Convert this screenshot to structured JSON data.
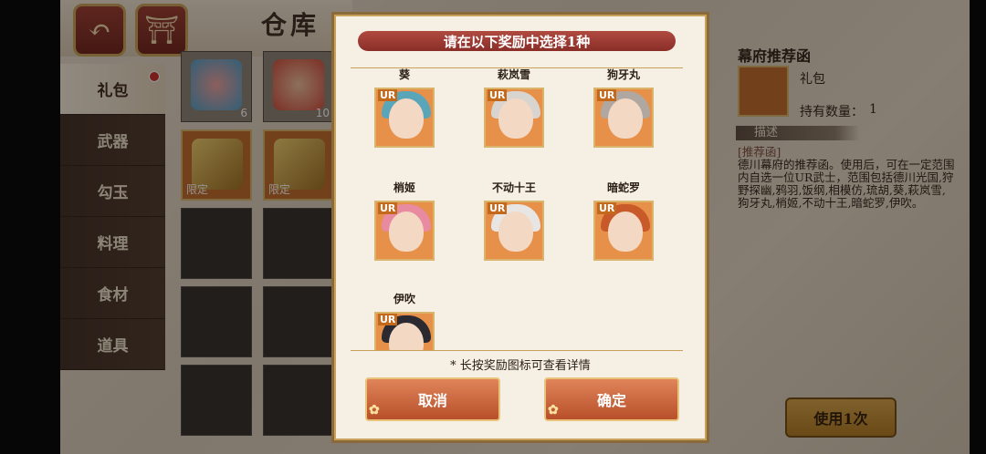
{
  "header": {
    "title": "仓库"
  },
  "sidebar": {
    "items": [
      {
        "label": "礼包",
        "active": true,
        "badge": true
      },
      {
        "label": "武器",
        "active": false
      },
      {
        "label": "勾玉",
        "active": false
      },
      {
        "label": "料理",
        "active": false
      },
      {
        "label": "食材",
        "active": false
      },
      {
        "label": "道具",
        "active": false
      }
    ]
  },
  "grid": {
    "items": [
      {
        "count": "6",
        "tag": ""
      },
      {
        "count": "10",
        "tag": ""
      },
      {
        "count": "",
        "tag": "限定"
      },
      {
        "count": "",
        "tag": "限定"
      }
    ]
  },
  "modal": {
    "title": "请在以下奖励中选择1种",
    "rewards": [
      {
        "name": "葵",
        "rarity": "UR"
      },
      {
        "name": "萩岚雪",
        "rarity": "UR"
      },
      {
        "name": "狗牙丸",
        "rarity": "UR"
      },
      {
        "name": "梢姬",
        "rarity": "UR"
      },
      {
        "name": "不动十王",
        "rarity": "UR"
      },
      {
        "name": "暗蛇罗",
        "rarity": "UR"
      },
      {
        "name": "伊吹",
        "rarity": "UR"
      }
    ],
    "hint": "* 长按奖励图标可查看详情",
    "cancel_label": "取消",
    "confirm_label": "确定"
  },
  "info": {
    "title": "幕府推荐函",
    "type": "礼包",
    "qty_label": "持有数量：",
    "qty_value": "1",
    "desc_label": "描述",
    "desc_tag": "[推荐函]",
    "desc_body": "德川幕府的推荐函。使用后，可在一定范围内自选一位UR武士，范围包括德川光国,狩野探幽,鸦羽,饭纲,相模仿,琉胡,葵,萩岚雪,狗牙丸,梢姬,不动十王,暗蛇罗,伊吹。",
    "use_label": "使用1次"
  }
}
